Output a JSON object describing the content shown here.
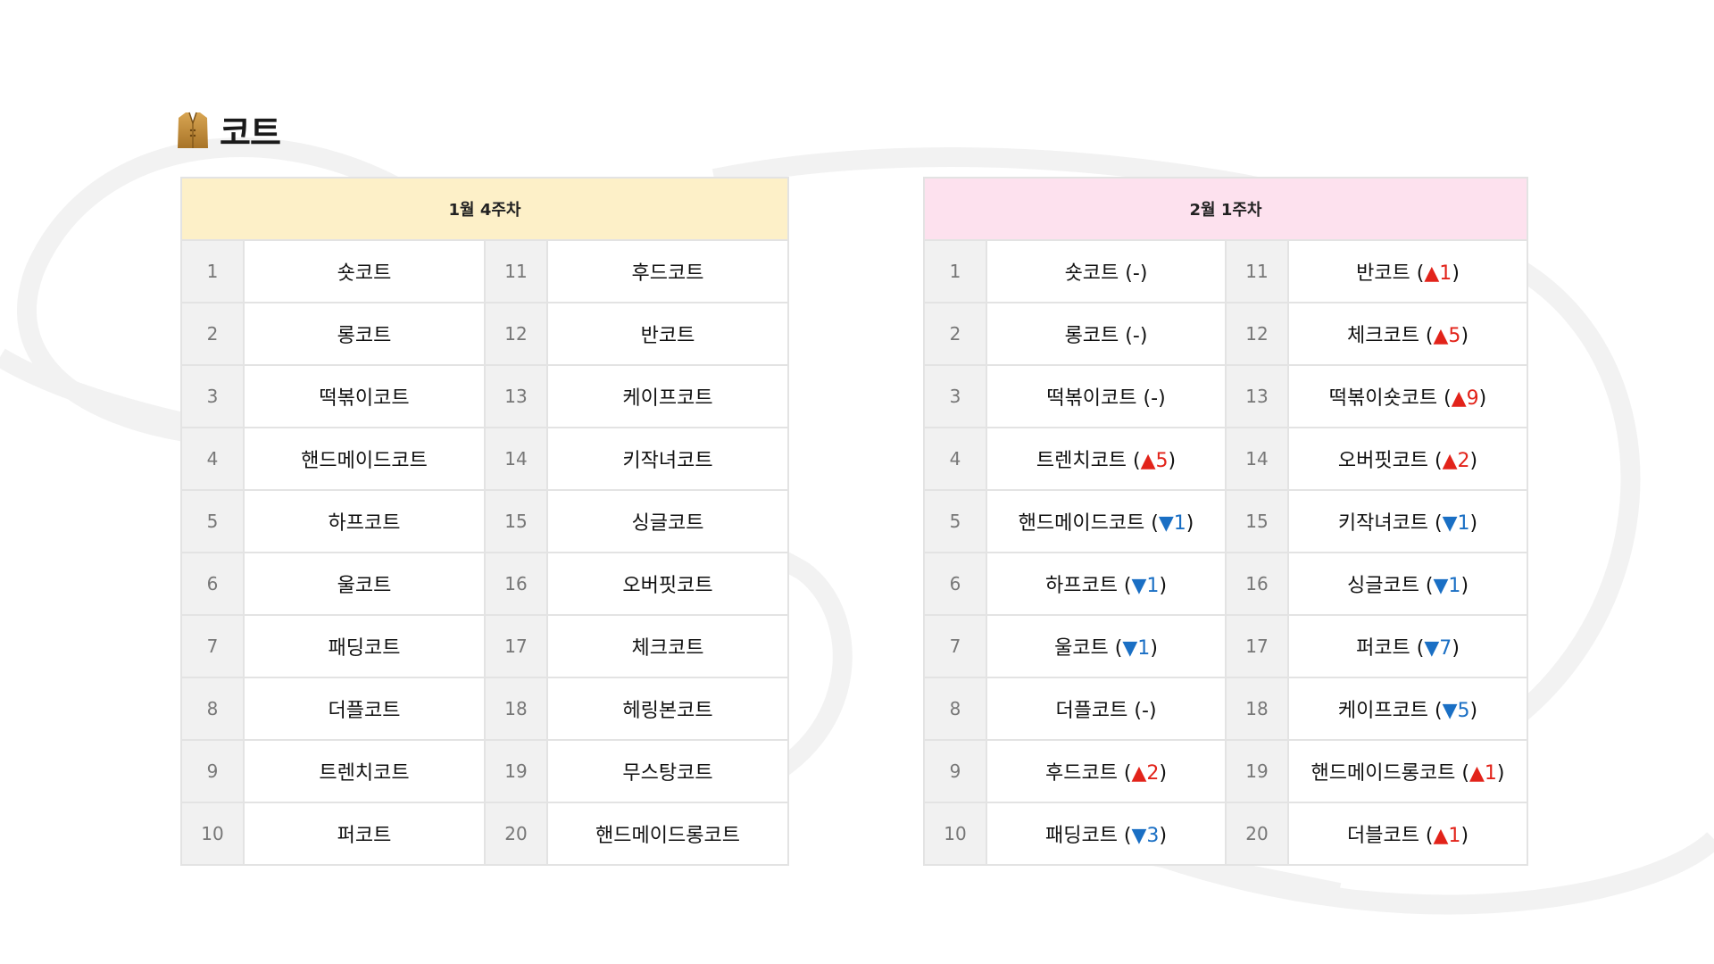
{
  "title": "코트",
  "colors": {
    "header_left_bg": "#fdf0c8",
    "header_right_bg": "#fde1ee",
    "rank_cell_bg": "#f1f1f1",
    "up": "#e2231a",
    "down": "#1a6fc4"
  },
  "icon": "coat-icon",
  "tables": [
    {
      "header": "1월 4주차",
      "rows": [
        {
          "rank_a": "1",
          "name_a": "숏코트",
          "rank_b": "11",
          "name_b": "후드코트"
        },
        {
          "rank_a": "2",
          "name_a": "롱코트",
          "rank_b": "12",
          "name_b": "반코트"
        },
        {
          "rank_a": "3",
          "name_a": "떡볶이코트",
          "rank_b": "13",
          "name_b": "케이프코트"
        },
        {
          "rank_a": "4",
          "name_a": "핸드메이드코트",
          "rank_b": "14",
          "name_b": "키작녀코트"
        },
        {
          "rank_a": "5",
          "name_a": "하프코트",
          "rank_b": "15",
          "name_b": "싱글코트"
        },
        {
          "rank_a": "6",
          "name_a": "울코트",
          "rank_b": "16",
          "name_b": "오버핏코트"
        },
        {
          "rank_a": "7",
          "name_a": "패딩코트",
          "rank_b": "17",
          "name_b": "체크코트"
        },
        {
          "rank_a": "8",
          "name_a": "더플코트",
          "rank_b": "18",
          "name_b": "헤링본코트"
        },
        {
          "rank_a": "9",
          "name_a": "트렌치코트",
          "rank_b": "19",
          "name_b": "무스탕코트"
        },
        {
          "rank_a": "10",
          "name_a": "퍼코트",
          "rank_b": "20",
          "name_b": "핸드메이드롱코트"
        }
      ]
    },
    {
      "header": "2월 1주차",
      "rows": [
        {
          "rank_a": "1",
          "name_a": "숏코트",
          "chg_a": "-",
          "rank_b": "11",
          "name_b": "반코트",
          "chg_b": "▲1"
        },
        {
          "rank_a": "2",
          "name_a": "롱코트",
          "chg_a": "-",
          "rank_b": "12",
          "name_b": "체크코트",
          "chg_b": "▲5"
        },
        {
          "rank_a": "3",
          "name_a": "떡볶이코트",
          "chg_a": "-",
          "rank_b": "13",
          "name_b": "떡볶이숏코트",
          "chg_b": "▲9"
        },
        {
          "rank_a": "4",
          "name_a": "트렌치코트",
          "chg_a": "▲5",
          "rank_b": "14",
          "name_b": "오버핏코트",
          "chg_b": "▲2"
        },
        {
          "rank_a": "5",
          "name_a": "핸드메이드코트",
          "chg_a": "▼1",
          "rank_b": "15",
          "name_b": "키작녀코트",
          "chg_b": "▼1"
        },
        {
          "rank_a": "6",
          "name_a": "하프코트",
          "chg_a": "▼1",
          "rank_b": "16",
          "name_b": "싱글코트",
          "chg_b": "▼1"
        },
        {
          "rank_a": "7",
          "name_a": "울코트",
          "chg_a": "▼1",
          "rank_b": "17",
          "name_b": "퍼코트",
          "chg_b": "▼7"
        },
        {
          "rank_a": "8",
          "name_a": "더플코트",
          "chg_a": "-",
          "rank_b": "18",
          "name_b": "케이프코트",
          "chg_b": "▼5"
        },
        {
          "rank_a": "9",
          "name_a": "후드코트",
          "chg_a": "▲2",
          "rank_b": "19",
          "name_b": "핸드메이드롱코트",
          "chg_b": "▲1"
        },
        {
          "rank_a": "10",
          "name_a": "패딩코트",
          "chg_a": "▼3",
          "rank_b": "20",
          "name_b": "더블코트",
          "chg_b": "▲1"
        }
      ]
    }
  ]
}
